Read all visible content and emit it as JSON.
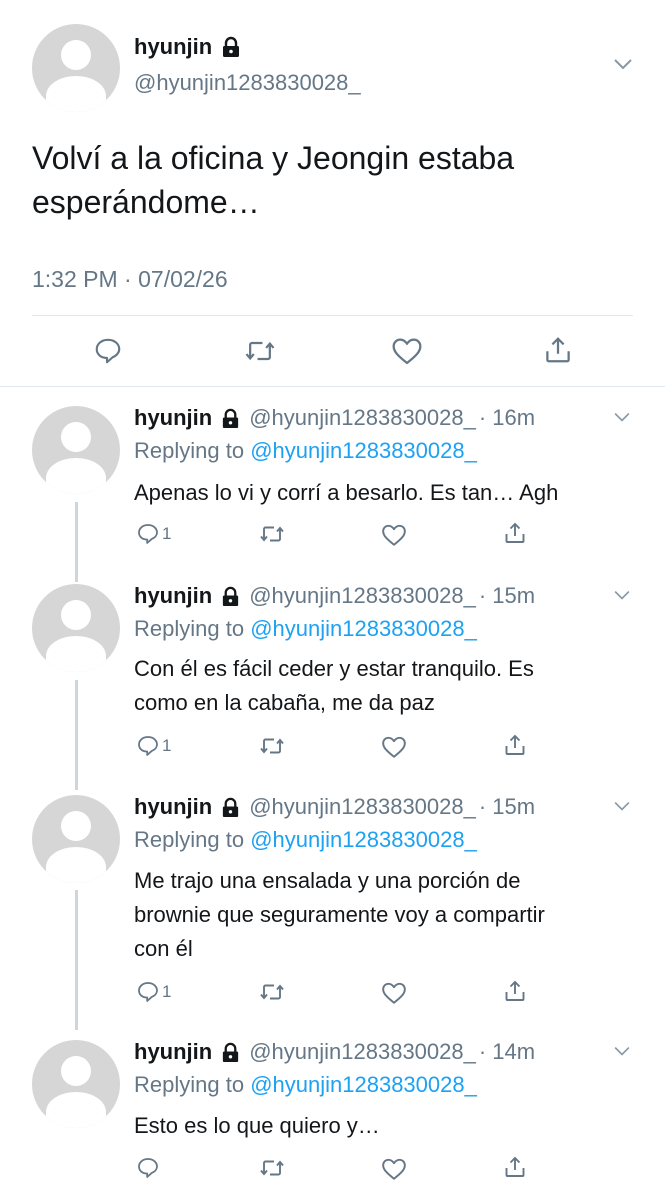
{
  "main_tweet": {
    "name": "hyunjin",
    "handle": "@hyunjin1283830028_",
    "text_line1": "Volví a la oficina y Jeongin estaba",
    "text_line2": "esperándome…",
    "time": "1:32 PM",
    "separator": "·",
    "date": "07/02/26"
  },
  "replies": [
    {
      "name": "hyunjin",
      "handle": "@hyunjin1283830028_",
      "age": "· 16m",
      "replying_label": "Replying to",
      "replying_to": "@hyunjin1283830028_",
      "lines": [
        "Apenas lo vi y corrí a besarlo. Es tan… Agh"
      ],
      "reply_count": "1"
    },
    {
      "name": "hyunjin",
      "handle": "@hyunjin1283830028_",
      "age": "· 15m",
      "replying_label": "Replying to",
      "replying_to": "@hyunjin1283830028_",
      "lines": [
        "Con él es fácil ceder y estar tranquilo. Es",
        "como en la cabaña, me da paz"
      ],
      "reply_count": "1"
    },
    {
      "name": "hyunjin",
      "handle": "@hyunjin1283830028_",
      "age": "· 15m",
      "replying_label": "Replying to",
      "replying_to": "@hyunjin1283830028_",
      "lines": [
        "Me trajo una ensalada y una porción de",
        "brownie que seguramente voy a compartir",
        "con él"
      ],
      "reply_count": "1"
    },
    {
      "name": "hyunjin",
      "handle": "@hyunjin1283830028_",
      "age": "· 14m",
      "replying_label": "Replying to",
      "replying_to": "@hyunjin1283830028_",
      "lines": [
        "Esto es lo que quiero y…"
      ],
      "reply_count": ""
    }
  ],
  "icons": [
    "reply-icon",
    "retweet-icon",
    "like-icon",
    "share-icon",
    "lock-icon",
    "chevron-down-icon"
  ],
  "colors": {
    "link": "#1da1f2",
    "secondary": "#657786",
    "avatar": "#d6d6d6",
    "divider": "#e1e8ed"
  }
}
